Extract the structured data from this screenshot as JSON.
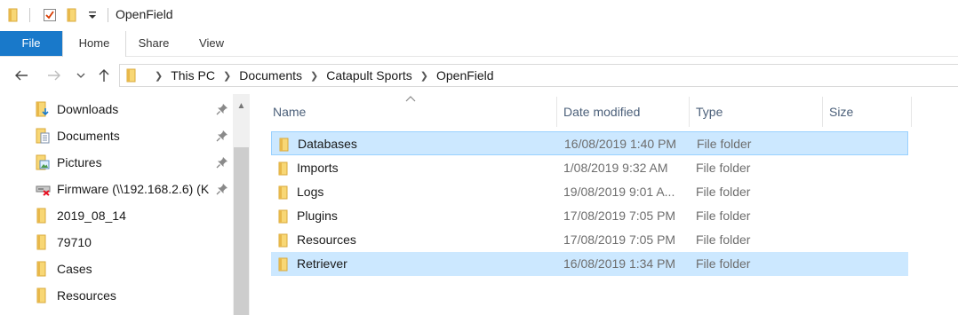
{
  "window": {
    "title": "OpenField"
  },
  "ribbon": {
    "tabs": [
      "File",
      "Home",
      "Share",
      "View"
    ]
  },
  "address": {
    "crumbs": [
      "This PC",
      "Documents",
      "Catapult Sports",
      "OpenField"
    ]
  },
  "sidebar": {
    "items": [
      {
        "label": "Downloads",
        "icon": "downloads-folder-icon",
        "pinned": true
      },
      {
        "label": "Documents",
        "icon": "documents-folder-icon",
        "pinned": true
      },
      {
        "label": "Pictures",
        "icon": "pictures-folder-icon",
        "pinned": true
      },
      {
        "label": "Firmware (\\\\192.168.2.6) (K",
        "icon": "disconnected-network-drive-icon",
        "pinned": true
      },
      {
        "label": "2019_08_14",
        "icon": "folder-icon",
        "pinned": false
      },
      {
        "label": "79710",
        "icon": "folder-icon",
        "pinned": false
      },
      {
        "label": "Cases",
        "icon": "folder-icon",
        "pinned": false
      },
      {
        "label": "Resources",
        "icon": "folder-icon",
        "pinned": false
      }
    ]
  },
  "columns": {
    "name": "Name",
    "date": "Date modified",
    "type": "Type",
    "size": "Size"
  },
  "files": [
    {
      "name": "Databases",
      "date": "16/08/2019 1:40 PM",
      "type": "File folder"
    },
    {
      "name": "Imports",
      "date": "1/08/2019 9:32 AM",
      "type": "File folder"
    },
    {
      "name": "Logs",
      "date": "19/08/2019 9:01 A...",
      "type": "File folder"
    },
    {
      "name": "Plugins",
      "date": "17/08/2019 7:05 PM",
      "type": "File folder"
    },
    {
      "name": "Resources",
      "date": "17/08/2019 7:05 PM",
      "type": "File folder"
    },
    {
      "name": "Retriever",
      "date": "16/08/2019 1:34 PM",
      "type": "File folder"
    }
  ],
  "colors": {
    "accent": "#1979ca",
    "selection": "#cce8ff",
    "selection_border": "#99d1ff",
    "folder": "#f8d775"
  }
}
